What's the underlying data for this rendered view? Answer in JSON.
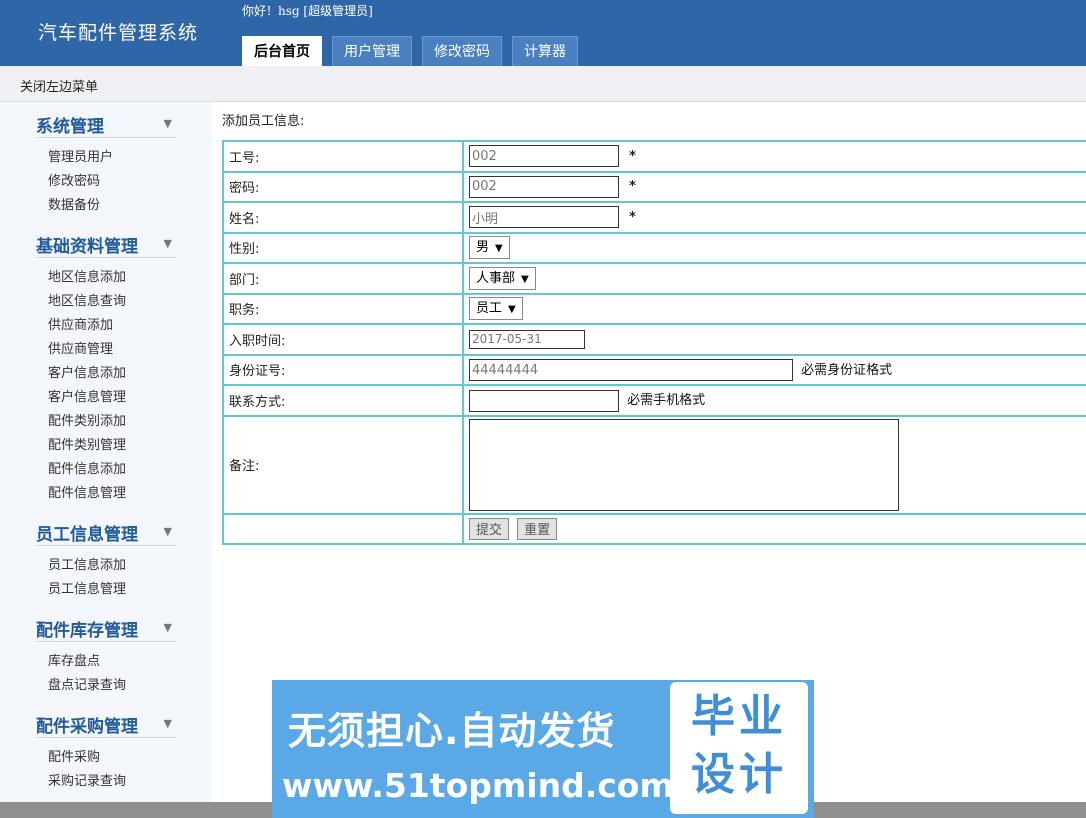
{
  "header": {
    "app_title": "汽车配件管理系统",
    "greeting": "你好！hsg [超级管理员]",
    "tabs": [
      {
        "label": "后台首页",
        "active": true
      },
      {
        "label": "用户管理",
        "active": false
      },
      {
        "label": "修改密码",
        "active": false
      },
      {
        "label": "计算器",
        "active": false
      }
    ]
  },
  "subbar": {
    "toggle_label": "关闭左边菜单"
  },
  "sidebar": {
    "groups": [
      {
        "title": "系统管理",
        "items": [
          "管理员用户",
          "修改密码",
          "数据备份"
        ]
      },
      {
        "title": "基础资料管理",
        "items": [
          "地区信息添加",
          "地区信息查询",
          "供应商添加",
          "供应商管理",
          "客户信息添加",
          "客户信息管理",
          "配件类别添加",
          "配件类别管理",
          "配件信息添加",
          "配件信息管理"
        ]
      },
      {
        "title": "员工信息管理",
        "items": [
          "员工信息添加",
          "员工信息管理"
        ]
      },
      {
        "title": "配件库存管理",
        "items": [
          "库存盘点",
          "盘点记录查询"
        ]
      },
      {
        "title": "配件采购管理",
        "items": [
          "配件采购",
          "采购记录查询"
        ]
      }
    ],
    "arrow_icon": "▼"
  },
  "form": {
    "title": "添加员工信息:",
    "star": "*",
    "fields": {
      "employee_id": {
        "label": "工号:",
        "value": "002"
      },
      "password": {
        "label": "密码:",
        "value": "002"
      },
      "name": {
        "label": "姓名:",
        "value": "小明"
      },
      "gender": {
        "label": "性别:",
        "value": "男"
      },
      "department": {
        "label": "部门:",
        "value": "人事部"
      },
      "position": {
        "label": "职务:",
        "value": "员工"
      },
      "hire_date": {
        "label": "入职时间:",
        "value": "2017-05-31"
      },
      "id_card": {
        "label": "身份证号:",
        "value": "44444444",
        "hint": "必需身份证格式"
      },
      "contact": {
        "label": "联系方式:",
        "value": "",
        "hint": "必需手机格式"
      },
      "remark": {
        "label": "备注:",
        "value": ""
      }
    },
    "submit_label": "提交",
    "reset_label": "重置"
  },
  "watermark": {
    "line1": "无须担心.自动发货",
    "line2": "www.51topmind.com",
    "box_text": "毕业设计"
  },
  "colors": {
    "header_bg": "#2f66a8",
    "table_border": "#5ec9d3",
    "menu_title": "#1f5a9c",
    "watermark_bg": "#5aa8e6"
  }
}
